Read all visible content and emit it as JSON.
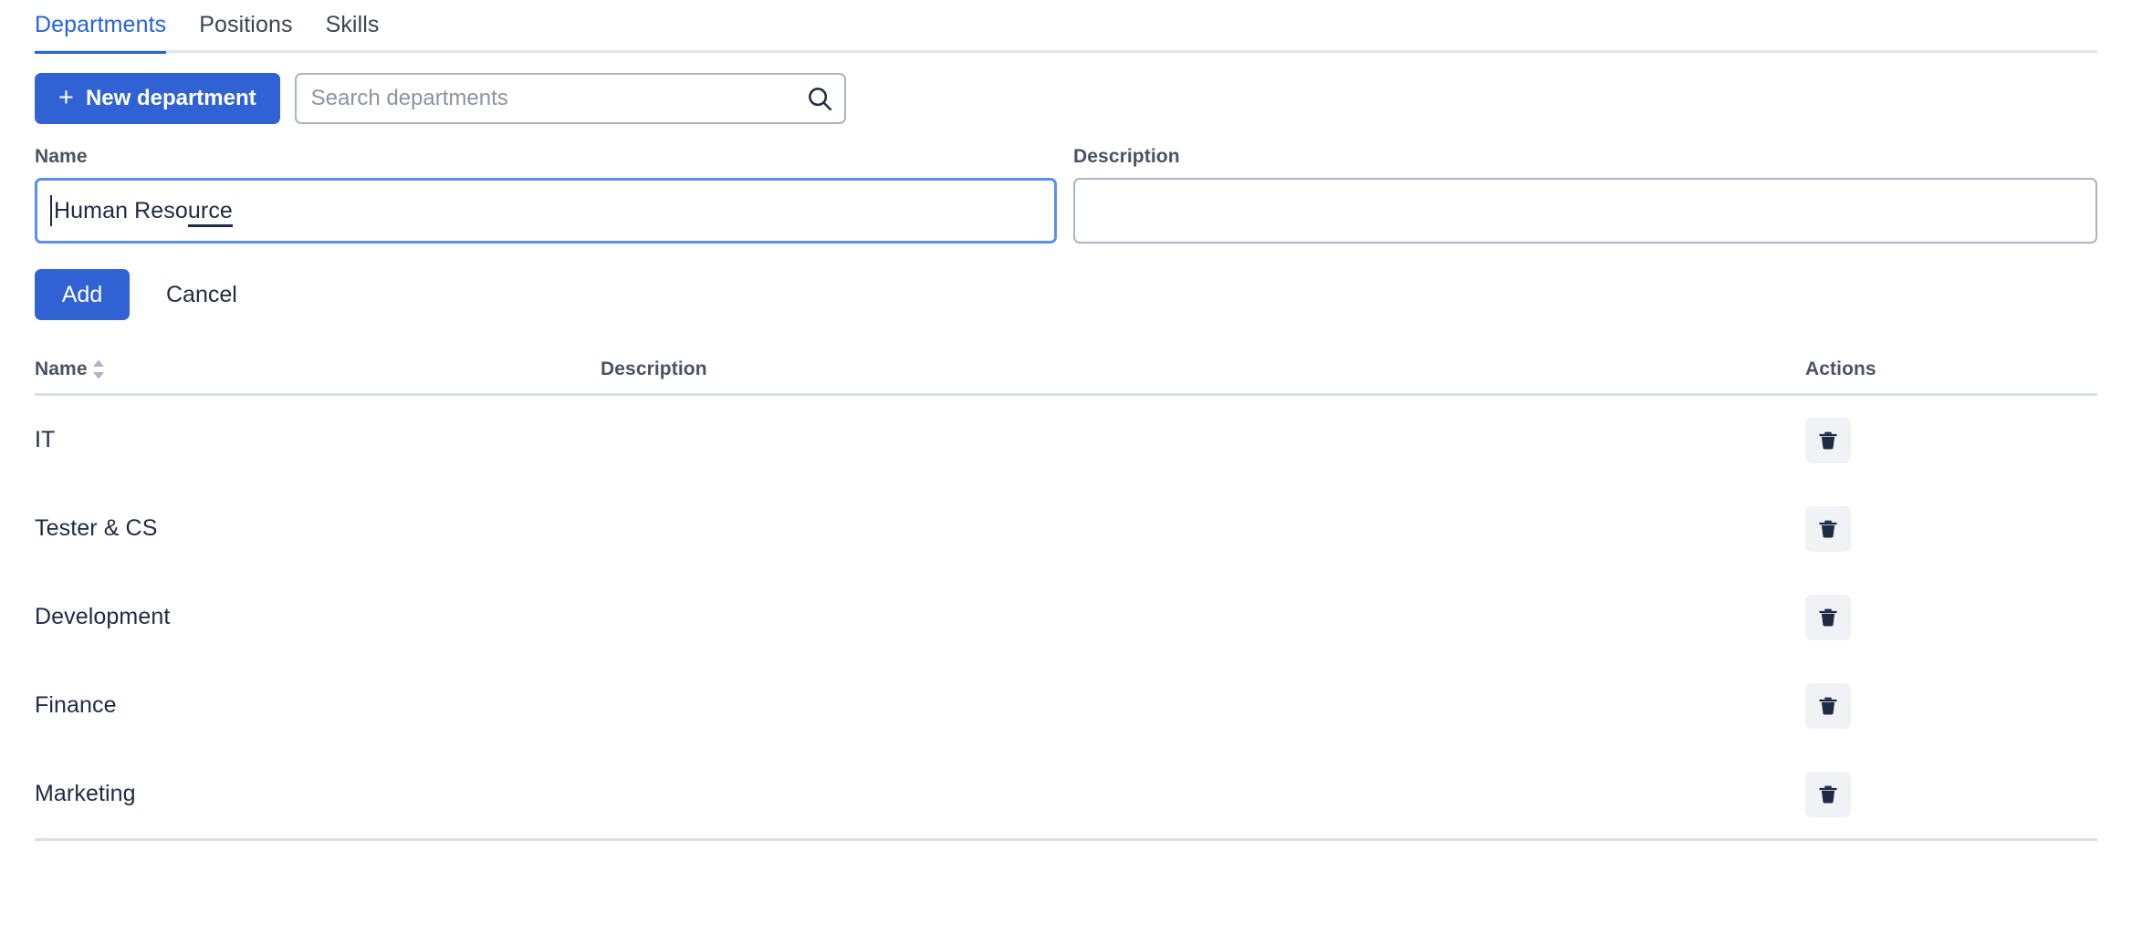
{
  "tabs": [
    {
      "label": "Departments",
      "active": true,
      "name": "tab-departments"
    },
    {
      "label": "Positions",
      "active": false,
      "name": "tab-positions"
    },
    {
      "label": "Skills",
      "active": false,
      "name": "tab-skills"
    }
  ],
  "toolbar": {
    "new_department_label": "New department",
    "new_department_icon": "plus-icon",
    "plus_glyph": "+",
    "search_placeholder": "Search departments",
    "search_value": "",
    "search_icon": "search-icon"
  },
  "form": {
    "name_label": "Name",
    "name_value": "Human Resource",
    "name_value_prefix": "Human Reso",
    "name_value_misspelled": "urce",
    "name_placeholder": "",
    "description_label": "Description",
    "description_value": "",
    "description_placeholder": "",
    "add_label": "Add",
    "cancel_label": "Cancel"
  },
  "table": {
    "columns": [
      {
        "key": "name",
        "label": "Name",
        "sortable": true,
        "sort_icon": "sort-updown-icon"
      },
      {
        "key": "description",
        "label": "Description",
        "sortable": false
      },
      {
        "key": "actions",
        "label": "Actions",
        "sortable": false
      }
    ],
    "rows": [
      {
        "name": "IT",
        "description": "",
        "delete_icon": "trash-icon"
      },
      {
        "name": "Tester & CS",
        "description": "",
        "delete_icon": "trash-icon"
      },
      {
        "name": "Development",
        "description": "",
        "delete_icon": "trash-icon"
      },
      {
        "name": "Finance",
        "description": "",
        "delete_icon": "trash-icon"
      },
      {
        "name": "Marketing",
        "description": "",
        "delete_icon": "trash-icon"
      }
    ]
  },
  "colors": {
    "accent": "#2563d9",
    "button_primary": "#3062d4",
    "focus_border": "#5a8ef0",
    "text_dark": "#1f2a44",
    "text_muted": "#4a5264",
    "border": "#adb3bf",
    "divider": "#dcdee5",
    "icon_button_bg": "#f0f2f5"
  }
}
